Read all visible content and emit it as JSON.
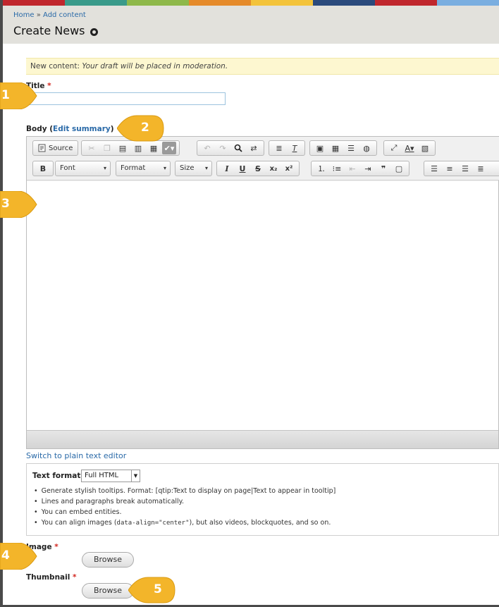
{
  "stripe_colors": [
    "#c0272d",
    "#3a9a8a",
    "#8eb84a",
    "#e58a2a",
    "#f3c33b",
    "#2b4a7c",
    "#c0272d",
    "#7aaee0"
  ],
  "breadcrumb": {
    "home": "Home",
    "separator": "»",
    "current": "Add content"
  },
  "page_title": "Create News",
  "notice": {
    "prefix": "New content:",
    "message": "Your draft will be placed in moderation."
  },
  "title_field": {
    "label": "Title",
    "required_mark": "*",
    "value": ""
  },
  "body_field": {
    "label": "Body (",
    "summary_link": "Edit summary",
    "close": ")"
  },
  "toolbar": {
    "source_label": "Source",
    "font_label": "Font",
    "format_label": "Format",
    "size_label": "Size"
  },
  "switch_editor_link": "Switch to plain text editor",
  "text_format": {
    "label": "Text format",
    "selected": "Full HTML",
    "tips": [
      "Generate stylish tooltips. Format: [qtip:Text to display on page|Text to appear in tooltip]",
      "Lines and paragraphs break automatically.",
      "You can embed entities."
    ],
    "tip4_pre": "You can align images (",
    "tip4_code": "data-align=\"center\"",
    "tip4_post": "), but also videos, blockquotes, and so on."
  },
  "image_field": {
    "label": "Image",
    "required_mark": "*",
    "button": "Browse"
  },
  "thumbnail_field": {
    "label": "Thumbnail",
    "required_mark": "*",
    "button": "Browse"
  },
  "callouts": [
    "1",
    "2",
    "3",
    "4",
    "5"
  ],
  "callout_color": "#f3b52a"
}
